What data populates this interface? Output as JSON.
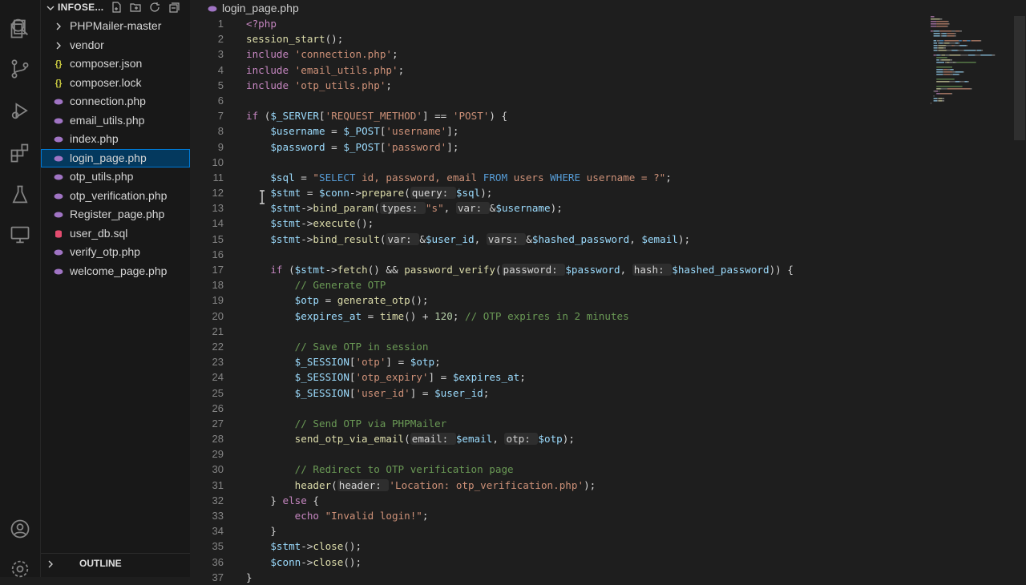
{
  "explorer": {
    "title": "INFOSE...",
    "files": [
      {
        "name": "PHPMailer-master",
        "type": "folder"
      },
      {
        "name": "vendor",
        "type": "folder"
      },
      {
        "name": "composer.json",
        "type": "json"
      },
      {
        "name": "composer.lock",
        "type": "json"
      },
      {
        "name": "connection.php",
        "type": "php"
      },
      {
        "name": "email_utils.php",
        "type": "php"
      },
      {
        "name": "index.php",
        "type": "php"
      },
      {
        "name": "login_page.php",
        "type": "php",
        "selected": true
      },
      {
        "name": "otp_utils.php",
        "type": "php"
      },
      {
        "name": "otp_verification.php",
        "type": "php"
      },
      {
        "name": "Register_page.php",
        "type": "php"
      },
      {
        "name": "user_db.sql",
        "type": "sql"
      },
      {
        "name": "verify_otp.php",
        "type": "php"
      },
      {
        "name": "welcome_page.php",
        "type": "php"
      }
    ],
    "outline_label": "OUTLINE"
  },
  "editor": {
    "tab_label": "login_page.php",
    "line_numbers": [
      "1",
      "2",
      "3",
      "4",
      "5",
      "6",
      "7",
      "8",
      "9",
      "10",
      "11",
      "12",
      "13",
      "14",
      "15",
      "16",
      "17",
      "18",
      "19",
      "20",
      "21",
      "22",
      "23",
      "24",
      "25",
      "26",
      "27",
      "28",
      "29",
      "30",
      "31",
      "32",
      "33",
      "34",
      "35",
      "36",
      "37"
    ],
    "lines": [
      [
        {
          "t": "<?php",
          "c": "kw"
        }
      ],
      [
        {
          "t": "session_start",
          "c": "fn"
        },
        {
          "t": "();",
          "c": "pu"
        }
      ],
      [
        {
          "t": "include ",
          "c": "kw"
        },
        {
          "t": "'connection.php'",
          "c": "st"
        },
        {
          "t": ";",
          "c": "pu"
        }
      ],
      [
        {
          "t": "include ",
          "c": "kw"
        },
        {
          "t": "'email_utils.php'",
          "c": "st"
        },
        {
          "t": ";",
          "c": "pu"
        }
      ],
      [
        {
          "t": "include ",
          "c": "kw"
        },
        {
          "t": "'otp_utils.php'",
          "c": "st"
        },
        {
          "t": ";",
          "c": "pu"
        }
      ],
      [],
      [
        {
          "t": "if ",
          "c": "kw"
        },
        {
          "t": "(",
          "c": "pu"
        },
        {
          "t": "$_SERVER",
          "c": "va"
        },
        {
          "t": "[",
          "c": "pu"
        },
        {
          "t": "'REQUEST_METHOD'",
          "c": "st"
        },
        {
          "t": "] == ",
          "c": "pu"
        },
        {
          "t": "'POST'",
          "c": "st"
        },
        {
          "t": ") {",
          "c": "pu"
        }
      ],
      [
        {
          "t": "    $username",
          "c": "va"
        },
        {
          "t": " = ",
          "c": "pu"
        },
        {
          "t": "$_POST",
          "c": "va"
        },
        {
          "t": "[",
          "c": "pu"
        },
        {
          "t": "'username'",
          "c": "st"
        },
        {
          "t": "];",
          "c": "pu"
        }
      ],
      [
        {
          "t": "    $password",
          "c": "va"
        },
        {
          "t": " = ",
          "c": "pu"
        },
        {
          "t": "$_POST",
          "c": "va"
        },
        {
          "t": "[",
          "c": "pu"
        },
        {
          "t": "'password'",
          "c": "st"
        },
        {
          "t": "];",
          "c": "pu"
        }
      ],
      [],
      [
        {
          "t": "    $sql",
          "c": "va"
        },
        {
          "t": " = ",
          "c": "pu"
        },
        {
          "t": "\"",
          "c": "st"
        },
        {
          "t": "SELECT",
          "c": "sq"
        },
        {
          "t": " id, password, email ",
          "c": "st"
        },
        {
          "t": "FROM",
          "c": "sq"
        },
        {
          "t": " users ",
          "c": "st"
        },
        {
          "t": "WHERE",
          "c": "sq"
        },
        {
          "t": " username = ?\"",
          "c": "st"
        },
        {
          "t": ";",
          "c": "pu"
        }
      ],
      [
        {
          "t": "    $stmt",
          "c": "va"
        },
        {
          "t": " = ",
          "c": "pu"
        },
        {
          "t": "$conn",
          "c": "va"
        },
        {
          "t": "->",
          "c": "pu"
        },
        {
          "t": "prepare",
          "c": "fn"
        },
        {
          "t": "(",
          "c": "pu"
        },
        {
          "t": "query: ",
          "c": "hint"
        },
        {
          "t": "$sql",
          "c": "va"
        },
        {
          "t": ");",
          "c": "pu"
        }
      ],
      [
        {
          "t": "    $stmt",
          "c": "va"
        },
        {
          "t": "->",
          "c": "pu"
        },
        {
          "t": "bind_param",
          "c": "fn"
        },
        {
          "t": "(",
          "c": "pu"
        },
        {
          "t": "types: ",
          "c": "hint"
        },
        {
          "t": "\"s\"",
          "c": "st"
        },
        {
          "t": ", ",
          "c": "pu"
        },
        {
          "t": "var: ",
          "c": "hint"
        },
        {
          "t": "&",
          "c": "pu"
        },
        {
          "t": "$username",
          "c": "va"
        },
        {
          "t": ");",
          "c": "pu"
        }
      ],
      [
        {
          "t": "    $stmt",
          "c": "va"
        },
        {
          "t": "->",
          "c": "pu"
        },
        {
          "t": "execute",
          "c": "fn"
        },
        {
          "t": "();",
          "c": "pu"
        }
      ],
      [
        {
          "t": "    $stmt",
          "c": "va"
        },
        {
          "t": "->",
          "c": "pu"
        },
        {
          "t": "bind_result",
          "c": "fn"
        },
        {
          "t": "(",
          "c": "pu"
        },
        {
          "t": "var: ",
          "c": "hint"
        },
        {
          "t": "&",
          "c": "pu"
        },
        {
          "t": "$user_id",
          "c": "va"
        },
        {
          "t": ", ",
          "c": "pu"
        },
        {
          "t": "vars: ",
          "c": "hint"
        },
        {
          "t": "&",
          "c": "pu"
        },
        {
          "t": "$hashed_password",
          "c": "va"
        },
        {
          "t": ", ",
          "c": "pu"
        },
        {
          "t": "$email",
          "c": "va"
        },
        {
          "t": ");",
          "c": "pu"
        }
      ],
      [],
      [
        {
          "t": "    if ",
          "c": "kw"
        },
        {
          "t": "(",
          "c": "pu"
        },
        {
          "t": "$stmt",
          "c": "va"
        },
        {
          "t": "->",
          "c": "pu"
        },
        {
          "t": "fetch",
          "c": "fn"
        },
        {
          "t": "() && ",
          "c": "pu"
        },
        {
          "t": "password_verify",
          "c": "fn"
        },
        {
          "t": "(",
          "c": "pu"
        },
        {
          "t": "password: ",
          "c": "hint"
        },
        {
          "t": "$password",
          "c": "va"
        },
        {
          "t": ", ",
          "c": "pu"
        },
        {
          "t": "hash: ",
          "c": "hint"
        },
        {
          "t": "$hashed_password",
          "c": "va"
        },
        {
          "t": ")) {",
          "c": "pu"
        }
      ],
      [
        {
          "t": "        // Generate OTP",
          "c": "cm"
        }
      ],
      [
        {
          "t": "        $otp",
          "c": "va"
        },
        {
          "t": " = ",
          "c": "pu"
        },
        {
          "t": "generate_otp",
          "c": "fn"
        },
        {
          "t": "();",
          "c": "pu"
        }
      ],
      [
        {
          "t": "        $expires_at",
          "c": "va"
        },
        {
          "t": " = ",
          "c": "pu"
        },
        {
          "t": "time",
          "c": "fn"
        },
        {
          "t": "() + ",
          "c": "pu"
        },
        {
          "t": "120",
          "c": "nu"
        },
        {
          "t": "; ",
          "c": "pu"
        },
        {
          "t": "// OTP expires in 2 minutes",
          "c": "cm"
        }
      ],
      [],
      [
        {
          "t": "        // Save OTP in session",
          "c": "cm"
        }
      ],
      [
        {
          "t": "        $_SESSION",
          "c": "va"
        },
        {
          "t": "[",
          "c": "pu"
        },
        {
          "t": "'otp'",
          "c": "st"
        },
        {
          "t": "] = ",
          "c": "pu"
        },
        {
          "t": "$otp",
          "c": "va"
        },
        {
          "t": ";",
          "c": "pu"
        }
      ],
      [
        {
          "t": "        $_SESSION",
          "c": "va"
        },
        {
          "t": "[",
          "c": "pu"
        },
        {
          "t": "'otp_expiry'",
          "c": "st"
        },
        {
          "t": "] = ",
          "c": "pu"
        },
        {
          "t": "$expires_at",
          "c": "va"
        },
        {
          "t": ";",
          "c": "pu"
        }
      ],
      [
        {
          "t": "        $_SESSION",
          "c": "va"
        },
        {
          "t": "[",
          "c": "pu"
        },
        {
          "t": "'user_id'",
          "c": "st"
        },
        {
          "t": "] = ",
          "c": "pu"
        },
        {
          "t": "$user_id",
          "c": "va"
        },
        {
          "t": ";",
          "c": "pu"
        }
      ],
      [],
      [
        {
          "t": "        // Send OTP via PHPMailer",
          "c": "cm"
        }
      ],
      [
        {
          "t": "        send_otp_via_email",
          "c": "fn"
        },
        {
          "t": "(",
          "c": "pu"
        },
        {
          "t": "email: ",
          "c": "hint"
        },
        {
          "t": "$email",
          "c": "va"
        },
        {
          "t": ", ",
          "c": "pu"
        },
        {
          "t": "otp: ",
          "c": "hint"
        },
        {
          "t": "$otp",
          "c": "va"
        },
        {
          "t": ");",
          "c": "pu"
        }
      ],
      [],
      [
        {
          "t": "        // Redirect to OTP verification page",
          "c": "cm"
        }
      ],
      [
        {
          "t": "        header",
          "c": "fn"
        },
        {
          "t": "(",
          "c": "pu"
        },
        {
          "t": "header: ",
          "c": "hint"
        },
        {
          "t": "'Location: otp_verification.php'",
          "c": "st"
        },
        {
          "t": ");",
          "c": "pu"
        }
      ],
      [
        {
          "t": "    } ",
          "c": "pu"
        },
        {
          "t": "else",
          "c": "kw"
        },
        {
          "t": " {",
          "c": "pu"
        }
      ],
      [
        {
          "t": "        echo ",
          "c": "kw"
        },
        {
          "t": "\"Invalid login!\"",
          "c": "st"
        },
        {
          "t": ";",
          "c": "pu"
        }
      ],
      [
        {
          "t": "    }",
          "c": "pu"
        }
      ],
      [
        {
          "t": "    $stmt",
          "c": "va"
        },
        {
          "t": "->",
          "c": "pu"
        },
        {
          "t": "close",
          "c": "fn"
        },
        {
          "t": "();",
          "c": "pu"
        }
      ],
      [
        {
          "t": "    $conn",
          "c": "va"
        },
        {
          "t": "->",
          "c": "pu"
        },
        {
          "t": "close",
          "c": "fn"
        },
        {
          "t": "();",
          "c": "pu"
        }
      ],
      [
        {
          "t": "}",
          "c": "pu"
        }
      ]
    ]
  },
  "colors": {
    "accent": "#0078d4",
    "selection": "#04395e",
    "php_icon": "#a074c4",
    "json_icon": "#cbcb41",
    "sql_icon": "#e34c6f"
  }
}
